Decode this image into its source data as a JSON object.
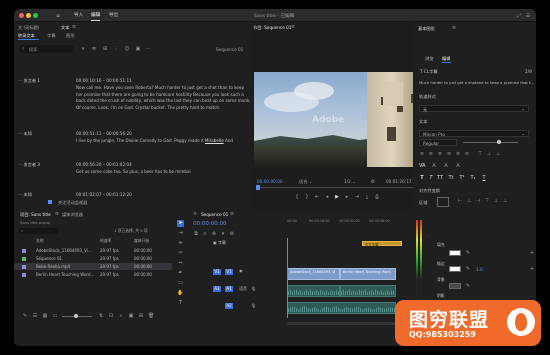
{
  "window": {
    "title": "Sans titre - 已編輯",
    "menu": [
      "导入",
      "编辑",
      "导出"
    ],
    "active_menu": "编辑"
  },
  "text_panel": {
    "tabs": [
      "文 (无标题)",
      "文本"
    ],
    "subtabs": [
      "转录文本",
      "字幕",
      "图形"
    ],
    "search_placeholder": "搜索",
    "sequence_label": "Sequence 01",
    "segments": [
      {
        "speaker": "发言者 1",
        "tc": "00:00:10:16 – 00:00:51:11",
        "text": "Now call me. Have you seen Roberta? Much harder to just get a shot than to keep her promise that there are going to be hardcore hostility Because you look such a back dated the crush of nobility, which was the last they can beat up on some monk. Of course. Look, I'm on God. Crystal bucket. The pretty hard to match."
      },
      {
        "speaker": "未知",
        "tc": "00:00:51:11 – 00:00:56:20",
        "text": "I live by the jungle, The Divine Comedy to God. Peggy made it ",
        "hl": "Mirabelle",
        "text_end": " And"
      },
      {
        "speaker": "发言者 3",
        "tc": "00:00:56:20 – 00:01:02:04",
        "text": "Get us some coke too. So plus, a beer has to be mimbai"
      },
      {
        "speaker": "未知",
        "tc": "00:01:02:07 – 00:01:12:20",
        "text": ""
      }
    ],
    "follow_label": "关注活动监视器"
  },
  "program": {
    "tab": "节目: Sequence 01",
    "timecode_left": "00:00:00:00",
    "fit": "适合",
    "ratio": "1/2",
    "timecode_right": "00:01:26:17",
    "watermark_text": "Adobe"
  },
  "graphics_panel": {
    "title": "基本图形",
    "tabs": [
      "浏览",
      "编辑"
    ],
    "layer_label": "CL字幕",
    "layer_count": "2/9",
    "layer_text": "Much harder to just get a shotand to keep a promise that t…",
    "track_style_label": "轨道样式",
    "track_style_value": "无",
    "text_label": "文本",
    "font": "Minion Pro",
    "weight": "Regular",
    "align_label": "对齐并变换",
    "zone_label": "区域",
    "appearance_label": "外观",
    "fill_label": "填充",
    "stroke_label": "描边",
    "bg_label": "背景",
    "shadow_label": "阴影",
    "stroke_val": "1.0"
  },
  "project": {
    "tab": "项目: Sans title",
    "tab2": "媒体浏览器",
    "file": "Sans title.prproj",
    "count": "1 项已选择, 共 5 项",
    "headers": [
      "名称",
      "帧速率",
      "媒体开始"
    ],
    "rows": [
      {
        "name": "AdobeStock_11664093_Vi…",
        "fps": "29.97 fps",
        "start": "00:00:00",
        "color": "#8a8fd1"
      },
      {
        "name": "Séquence 01",
        "fps": "29.97 fps",
        "start": "00:00:00",
        "color": "#5fb86b"
      },
      {
        "name": "Bebe Rexha.mp4",
        "fps": "29.97 fps",
        "start": "00:00:00",
        "color": "#8a8fd1"
      },
      {
        "name": "Berlin Heart Touching Word…",
        "fps": "29.97 fps",
        "start": "00:00:00",
        "color": "#8a8fd1"
      }
    ]
  },
  "timeline": {
    "tab": "Sequence 01",
    "timecode": "00:00:00:00",
    "caption_track": "字幕",
    "caption_clip": "中文字幕",
    "tracks": [
      "V1",
      "A1",
      "A2"
    ],
    "v1_label": "V1",
    "a1_label": "A1",
    "a2_label": "A2",
    "clip1": "AdobeStock_11664093_Vi",
    "clip2": "Berlin Heart Touching Word",
    "clip3": "Berlin Heart Touching Word",
    "voice_label": "语音",
    "ruler": [
      "00:00",
      "00:00:16:00",
      "00:00:32:00",
      "00:00:48:00",
      "00:01:04:00",
      "00:01:20:00"
    ]
  },
  "watermark": {
    "title": "图穷联盟",
    "qq": "QQ:985303259"
  }
}
